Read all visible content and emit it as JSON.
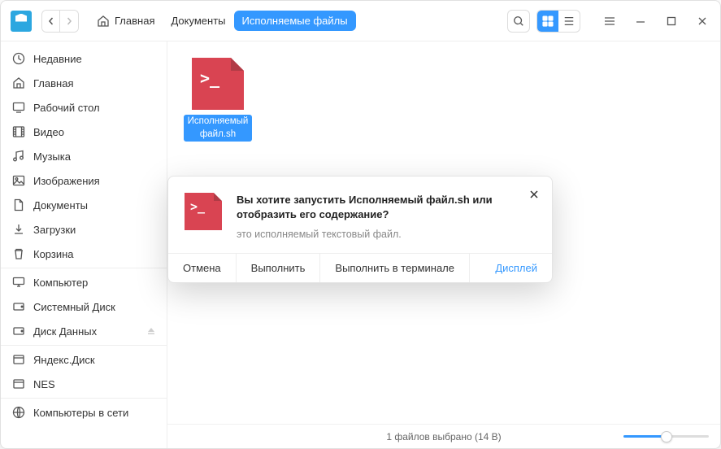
{
  "breadcrumb": [
    {
      "label": "Главная",
      "active": false,
      "icon": "home"
    },
    {
      "label": "Документы",
      "active": false
    },
    {
      "label": "Исполняемые файлы",
      "active": true
    }
  ],
  "sidebar": {
    "sections": [
      {
        "items": [
          {
            "id": "recent",
            "label": "Недавние",
            "icon": "clock"
          },
          {
            "id": "home",
            "label": "Главная",
            "icon": "home"
          },
          {
            "id": "desktop",
            "label": "Рабочий стол",
            "icon": "display"
          },
          {
            "id": "videos",
            "label": "Видео",
            "icon": "film"
          },
          {
            "id": "music",
            "label": "Музыка",
            "icon": "music"
          },
          {
            "id": "pictures",
            "label": "Изображения",
            "icon": "image"
          },
          {
            "id": "documents",
            "label": "Документы",
            "icon": "document"
          },
          {
            "id": "downloads",
            "label": "Загрузки",
            "icon": "download"
          },
          {
            "id": "trash",
            "label": "Корзина",
            "icon": "trash"
          }
        ]
      },
      {
        "items": [
          {
            "id": "computer",
            "label": "Компьютер",
            "icon": "computer"
          },
          {
            "id": "system-disk",
            "label": "Системный Диск",
            "icon": "disk"
          },
          {
            "id": "data-disk",
            "label": "Диск Данных",
            "icon": "disk",
            "eject": true
          }
        ]
      },
      {
        "items": [
          {
            "id": "yandex-disk",
            "label": "Яндекс.Диск",
            "icon": "yandex"
          },
          {
            "id": "nes",
            "label": "NES",
            "icon": "yandex"
          }
        ]
      },
      {
        "items": [
          {
            "id": "network",
            "label": "Компьютеры в сети",
            "icon": "network"
          }
        ]
      }
    ]
  },
  "files": [
    {
      "name": "Исполняемый файл.sh",
      "type": "sh",
      "selected": true
    }
  ],
  "statusbar": {
    "text": "1 файлов выбрано (14 B)"
  },
  "dialog": {
    "title": "Вы хотите запустить Исполняемый файл.sh или отобразить его содержание?",
    "subtitle": "это исполняемый текстовый файл.",
    "buttons": {
      "cancel": "Отмена",
      "run": "Выполнить",
      "run_terminal": "Выполнить в терминале",
      "display": "Дисплей"
    }
  }
}
